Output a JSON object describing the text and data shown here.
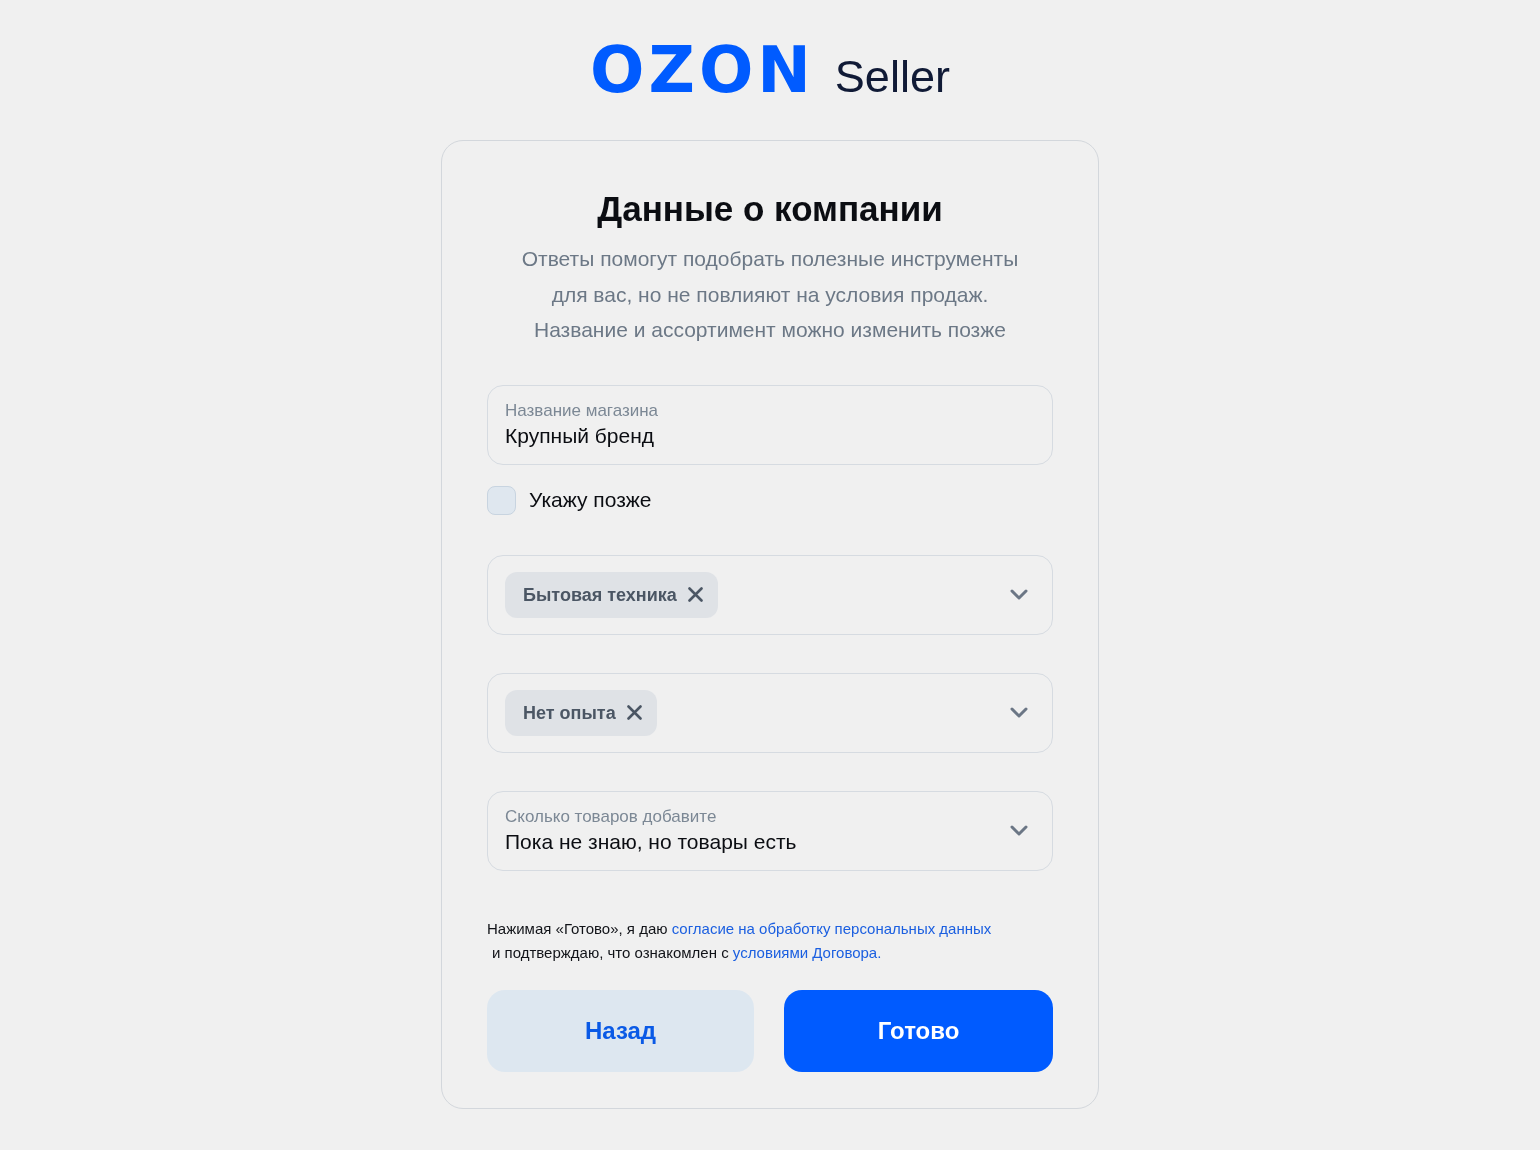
{
  "logo": {
    "brand": "OZON",
    "product": "Seller"
  },
  "card": {
    "title": "Данные о компании",
    "subtitle": "Ответы помогут подобрать полезные инструменты\nдля вас, но не повлияют на условия продаж.\nНазвание и ассортимент можно изменить позже"
  },
  "store_name": {
    "label": "Название магазина",
    "value": "Крупный бренд"
  },
  "later": {
    "label": "Укажу позже",
    "checked": false
  },
  "selects": [
    {
      "kind": "chips",
      "chips": [
        {
          "label": "Бытовая техника"
        }
      ]
    },
    {
      "kind": "chips",
      "chips": [
        {
          "label": "Нет опыта"
        }
      ]
    },
    {
      "kind": "value",
      "label": "Сколько товаров добавите",
      "value": "Пока не знаю, но товары есть"
    }
  ],
  "consent": {
    "lines": [
      [
        {
          "kind": "text",
          "text": "Нажимая «Готово», я даю "
        },
        {
          "kind": "link",
          "text": "согласие на обработку персональных данных"
        }
      ],
      [
        {
          "kind": "text",
          "text": "и подтверждаю, что ознакомлен с "
        },
        {
          "kind": "link",
          "text": "условиями Договора."
        }
      ]
    ]
  },
  "buttons": [
    {
      "kind": "secondary",
      "label": "Назад"
    },
    {
      "kind": "primary",
      "label": "Готово"
    }
  ]
}
